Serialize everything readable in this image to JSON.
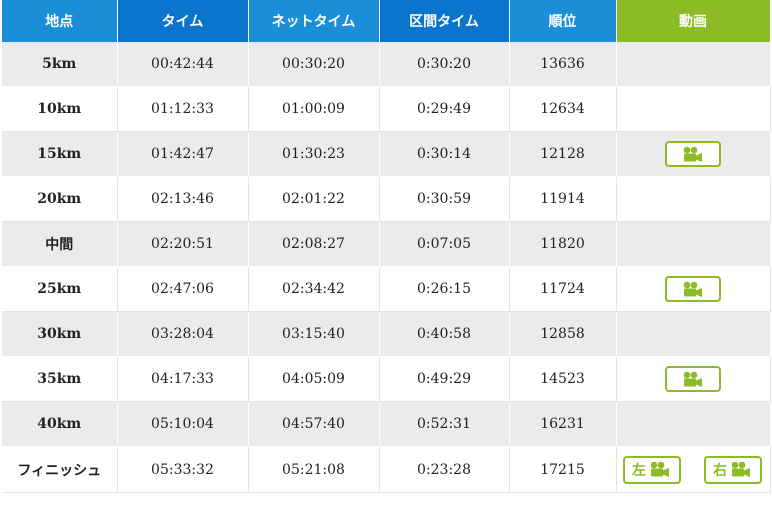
{
  "headers": {
    "point": "地点",
    "time": "タイム",
    "net_time": "ネットタイム",
    "split_time": "区間タイム",
    "rank": "順位",
    "video": "動画"
  },
  "rows": [
    {
      "point": "5km",
      "time": "00:42:44",
      "net_time": "00:30:20",
      "split_time": "0:30:20",
      "rank": "13636"
    },
    {
      "point": "10km",
      "time": "01:12:33",
      "net_time": "01:00:09",
      "split_time": "0:29:49",
      "rank": "12634"
    },
    {
      "point": "15km",
      "time": "01:42:47",
      "net_time": "01:30:23",
      "split_time": "0:30:14",
      "rank": "12128"
    },
    {
      "point": "20km",
      "time": "02:13:46",
      "net_time": "02:01:22",
      "split_time": "0:30:59",
      "rank": "11914"
    },
    {
      "point": "中間",
      "time": "02:20:51",
      "net_time": "02:08:27",
      "split_time": "0:07:05",
      "rank": "11820"
    },
    {
      "point": "25km",
      "time": "02:47:06",
      "net_time": "02:34:42",
      "split_time": "0:26:15",
      "rank": "11724"
    },
    {
      "point": "30km",
      "time": "03:28:04",
      "net_time": "03:15:40",
      "split_time": "0:40:58",
      "rank": "12858"
    },
    {
      "point": "35km",
      "time": "04:17:33",
      "net_time": "04:05:09",
      "split_time": "0:49:29",
      "rank": "14523"
    },
    {
      "point": "40km",
      "time": "05:10:04",
      "net_time": "04:57:40",
      "split_time": "0:52:31",
      "rank": "16231"
    },
    {
      "point": "フィニッシュ",
      "time": "05:33:32",
      "net_time": "05:21:08",
      "split_time": "0:23:28",
      "rank": "17215"
    }
  ],
  "finish_video": {
    "left_label": "左",
    "right_label": "右"
  },
  "colors": {
    "header_blue_light": "#1a8fd8",
    "header_blue_dark": "#0b74cc",
    "header_green": "#8cbc25",
    "row_gray": "#ebebed"
  },
  "icons": {
    "video": "video-camera-icon"
  }
}
